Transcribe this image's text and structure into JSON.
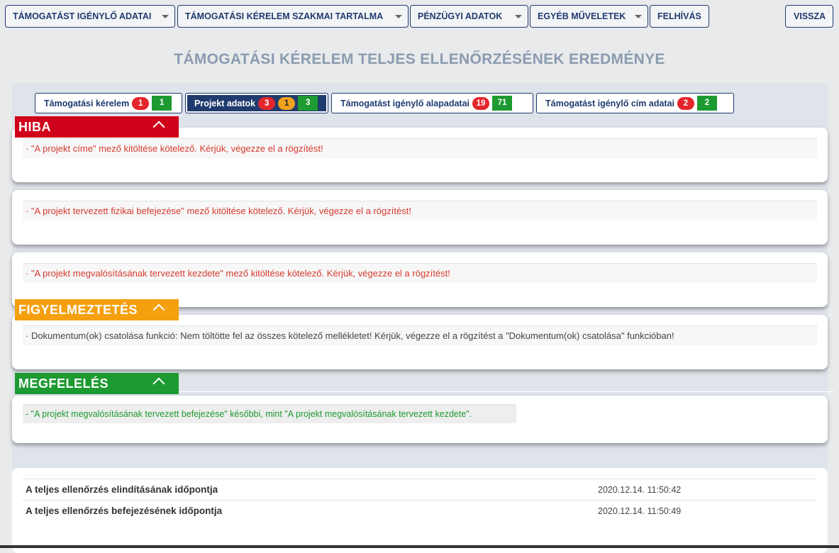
{
  "nav": {
    "items": [
      {
        "label": "TÁMOGATÁST IGÉNYLŐ ADATAI",
        "dropdown": true
      },
      {
        "label": "TÁMOGATÁSI KÉRELEM SZAKMAI TARTALMA",
        "dropdown": true
      },
      {
        "label": "PÉNZÜGYI ADATOK",
        "dropdown": true
      },
      {
        "label": "EGYÉB MŰVELETEK",
        "dropdown": true
      },
      {
        "label": "FELHÍVÁS",
        "dropdown": false
      }
    ],
    "back_label": "VISSZA"
  },
  "page_title": "TÁMOGATÁSI KÉRELEM TELJES ELLENŐRZÉSÉNEK EREDMÉNYE",
  "tabs": [
    {
      "label": "Támogatási kérelem",
      "errors": "1",
      "warnings": "",
      "ok": "1"
    },
    {
      "label": "Projekt adatok",
      "errors": "3",
      "warnings": "1",
      "ok": "3",
      "active": true
    },
    {
      "label": "Támogatást igénylő alapadatai",
      "errors": "19",
      "warnings": "",
      "ok": "71"
    },
    {
      "label": "Támogatást igénylő cím adatai",
      "errors": "2",
      "warnings": "",
      "ok": "2"
    }
  ],
  "sections": {
    "error": {
      "title": "HIBA",
      "color": "#d0021b",
      "messages": [
        "· \"A projekt címe\" mező kitöltése kötelező. Kérjük, végezze el a rögzítést!",
        "· \"A projekt tervezett fizikai befejezése\" mező kitöltése kötelező. Kérjük, végezze el a rögzítést!",
        "· \"A projekt megvalósításának tervezett kezdete\" mező kitöltése kötelező. Kérjük, végezze el a rögzítést!"
      ]
    },
    "warning": {
      "title": "FIGYELMEZTETÉS",
      "color": "#f5a00f",
      "messages": [
        "· Dokumentum(ok) csatolása funkció: Nem töltötte fel az összes kötelező mellékletet! Kérjük, végezze el a rögzítést a \"Dokumentum(ok) csatolása\" funkcióban!"
      ]
    },
    "ok": {
      "title": "MEGFELELÉS",
      "color": "#1d9a31",
      "messages": [
        "- \"A projekt megvalósításának tervezett befejezése\" későbbi, mint \"A projekt megvalósításának tervezett kezdete\"."
      ]
    }
  },
  "footer": {
    "start_label": "A teljes ellenőrzés elindításának időpontja",
    "start_value": "2020.12.14. 11:50:42",
    "end_label": "A teljes ellenőrzés befejezésének időpontja",
    "end_value": "2020.12.14. 11:50:49"
  }
}
